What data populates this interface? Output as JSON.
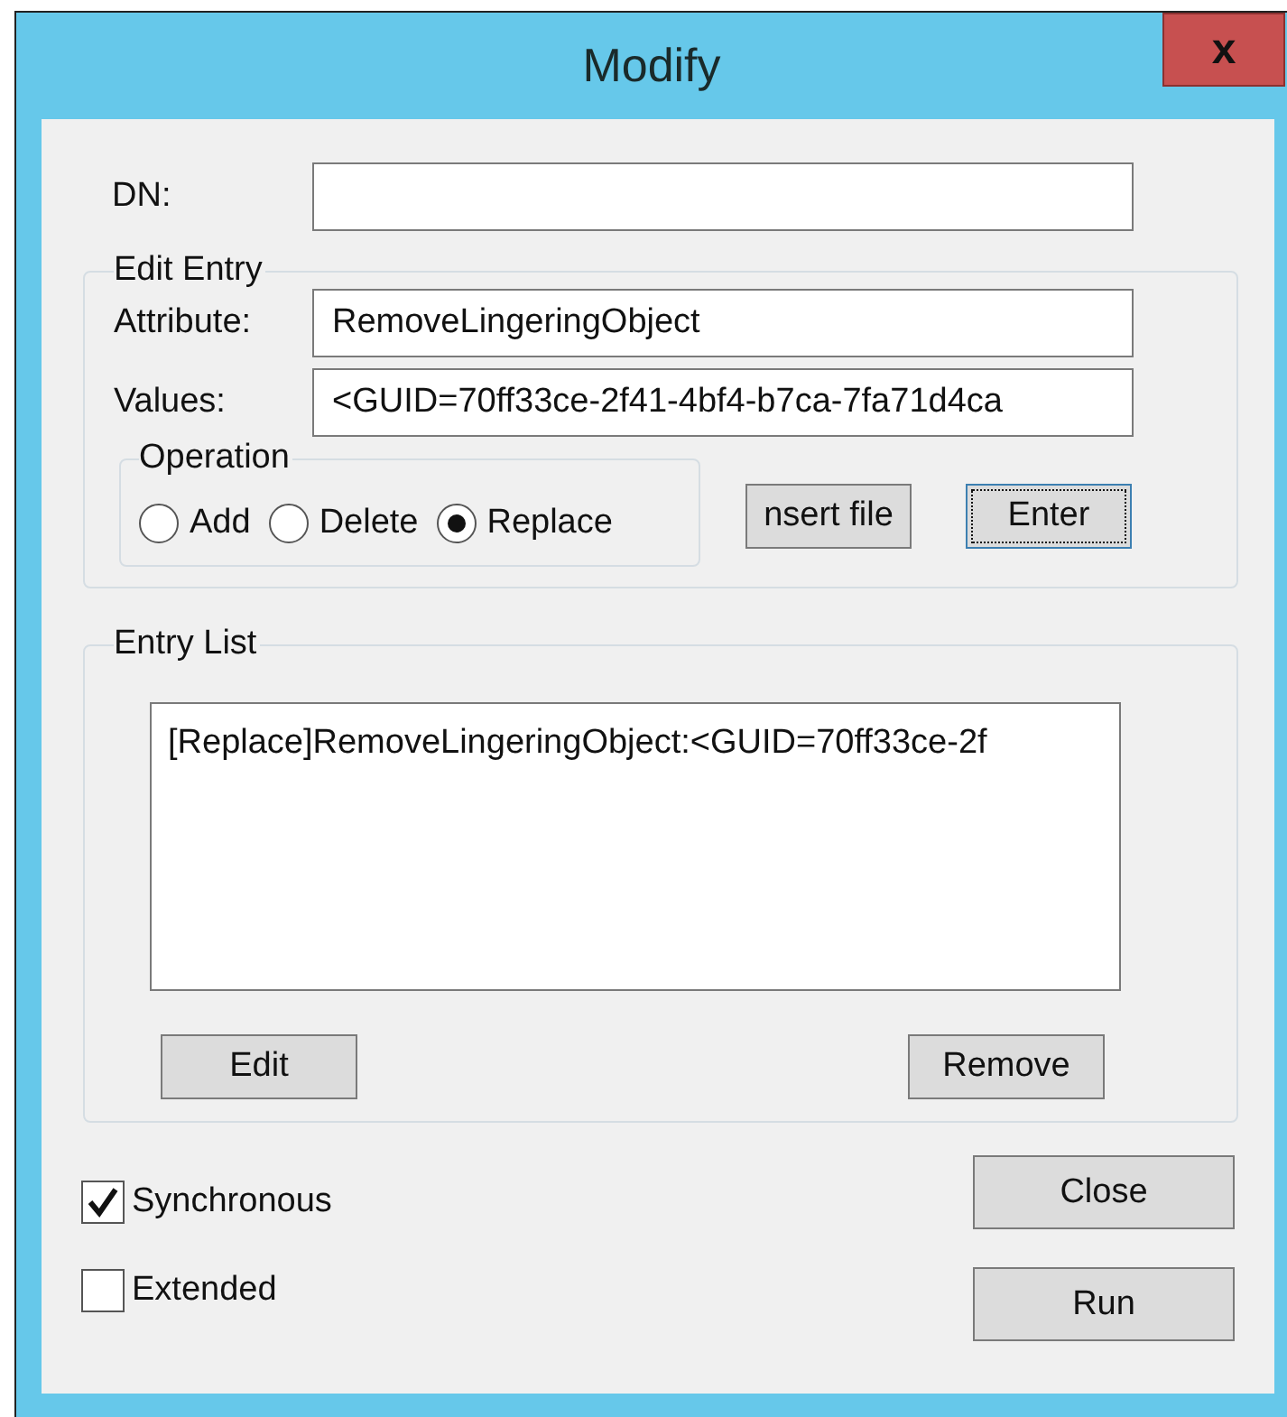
{
  "window": {
    "title": "Modify",
    "close": "x"
  },
  "dn": {
    "label": "DN:"
  },
  "edit_entry": {
    "title": "Edit Entry",
    "attribute": {
      "label": "Attribute:",
      "value": "RemoveLingeringObject"
    },
    "values": {
      "label": "Values:",
      "value": "<GUID=70ff33ce-2f41-4bf4-b7ca-7fa71d4ca"
    },
    "operation": {
      "title": "Operation",
      "options": [
        {
          "label": "Add",
          "selected": false
        },
        {
          "label": "Delete",
          "selected": false
        },
        {
          "label": "Replace",
          "selected": true
        }
      ]
    },
    "buttons": [
      {
        "label": "nsert file",
        "focused": false
      },
      {
        "label": "Enter",
        "focused": true
      }
    ]
  },
  "entry_list": {
    "title": "Entry List",
    "items": [
      "[Replace]RemoveLingeringObject:<GUID=70ff33ce-2f"
    ],
    "buttons": [
      "Edit",
      "Remove"
    ]
  },
  "options": [
    {
      "label": "Synchronous",
      "checked": true
    },
    {
      "label": "Extended",
      "checked": false
    }
  ],
  "actions": [
    "Close",
    "Run"
  ]
}
